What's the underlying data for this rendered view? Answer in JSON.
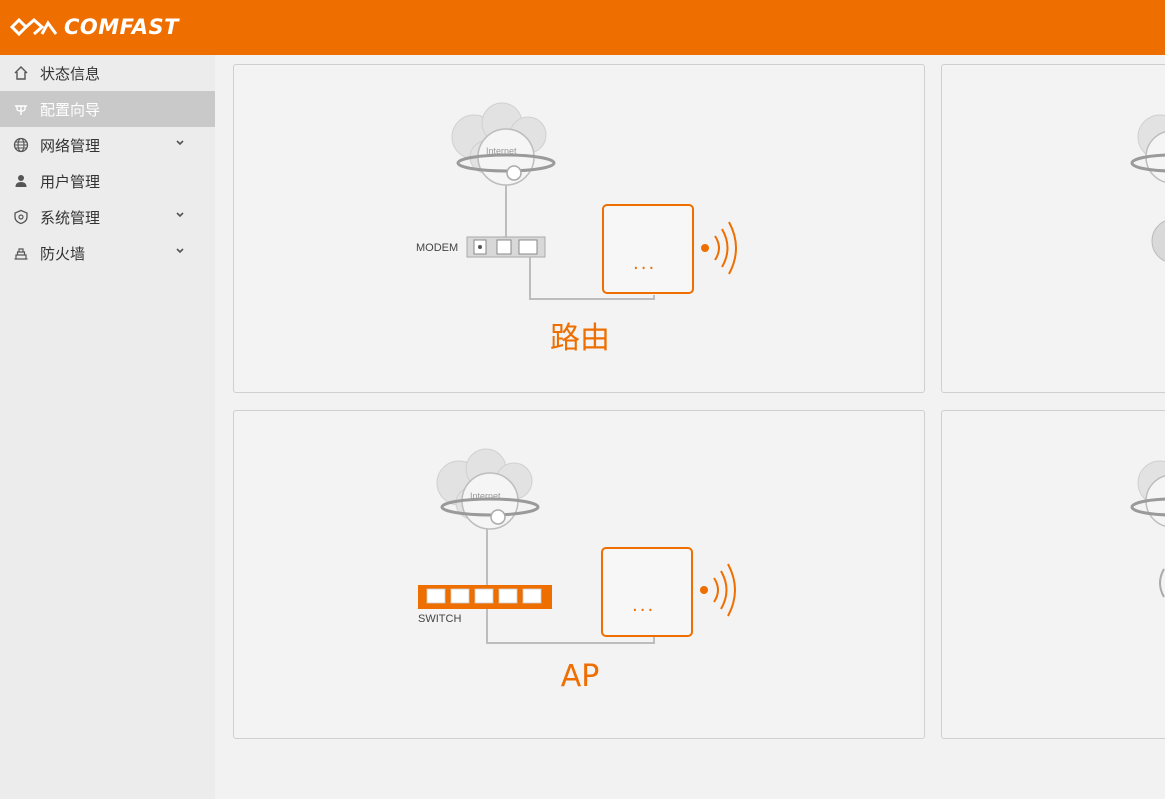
{
  "brand": {
    "name": "COMFAST",
    "color": "#ee6e00"
  },
  "sidebar": {
    "items": [
      {
        "label": "状态信息",
        "icon": "home-icon",
        "has_submenu": false
      },
      {
        "label": "配置向导",
        "icon": "wizard-icon",
        "has_submenu": false,
        "active": true
      },
      {
        "label": "网络管理",
        "icon": "globe-icon",
        "has_submenu": true
      },
      {
        "label": "用户管理",
        "icon": "user-icon",
        "has_submenu": false
      },
      {
        "label": "系统管理",
        "icon": "shield-icon",
        "has_submenu": true
      },
      {
        "label": "防火墙",
        "icon": "firewall-icon",
        "has_submenu": true
      }
    ]
  },
  "modes": [
    {
      "title": "路由",
      "device_label": "MODEM",
      "cloud_label": "Internet",
      "dots": "..."
    },
    {
      "title": "AP",
      "device_label": "SWITCH",
      "cloud_label": "Internet",
      "dots": "..."
    }
  ]
}
